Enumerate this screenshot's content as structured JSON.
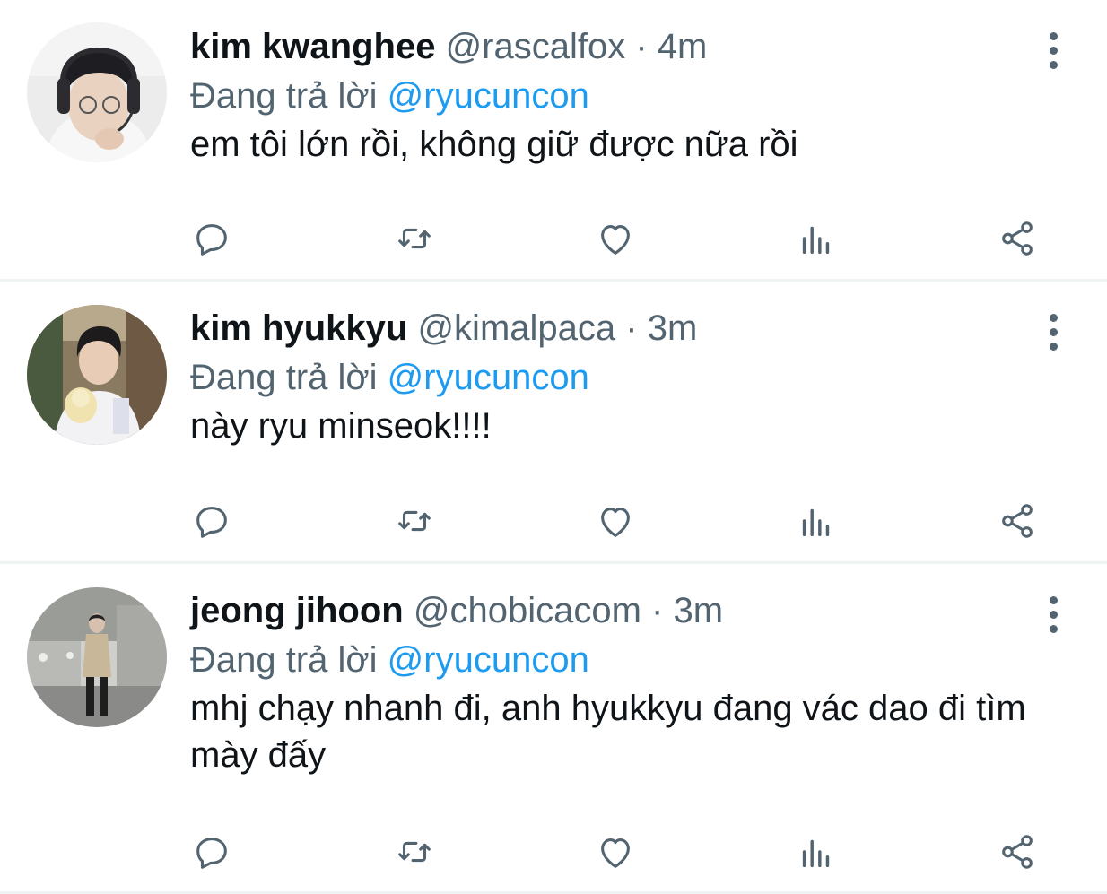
{
  "tweets": [
    {
      "name": "kim kwanghee",
      "handle": "@rascalfox",
      "separator": "·",
      "time": "4m",
      "reply_prefix": "Đang trả lời",
      "reply_to": "@ryucuncon",
      "text": "em tôi lớn rồi, không giữ được nữa rồi"
    },
    {
      "name": "kim hyukkyu",
      "handle": "@kimalpaca",
      "separator": "·",
      "time": "3m",
      "reply_prefix": "Đang trả lời",
      "reply_to": "@ryucuncon",
      "text": "này ryu minseok!!!!"
    },
    {
      "name": "jeong jihoon",
      "handle": "@chobicacom",
      "separator": "·",
      "time": "3m",
      "reply_prefix": "Đang trả lời",
      "reply_to": "@ryucuncon",
      "text": "mhj chạy nhanh đi, anh hyukkyu đang vác dao đi tìm mày đấy"
    }
  ],
  "icons": {
    "reply": "reply-icon",
    "retweet": "retweet-icon",
    "like": "heart-icon",
    "stats": "bar-chart-icon",
    "share": "share-icon",
    "more": "more-vertical-icon"
  },
  "colors": {
    "text_primary": "#0f1419",
    "text_secondary": "#536471",
    "mention": "#1d9bf0",
    "divider": "#eff3f4"
  }
}
